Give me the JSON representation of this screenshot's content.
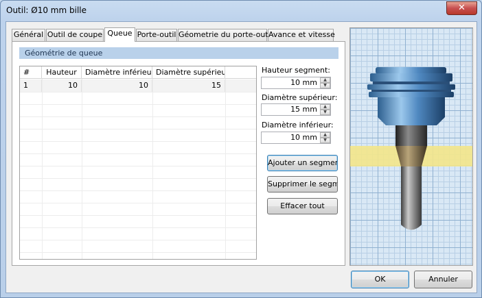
{
  "window": {
    "title": "Outil: Ø10 mm bille",
    "close_label": "✕"
  },
  "tabs": [
    {
      "label": "Général",
      "active": false
    },
    {
      "label": "Outil de coupe",
      "active": false
    },
    {
      "label": "Queue",
      "active": true
    },
    {
      "label": "Porte-outil",
      "active": false
    },
    {
      "label": "Géometrie du porte-outil",
      "active": false
    },
    {
      "label": "Avance et vitesse",
      "active": false
    }
  ],
  "section": {
    "title": "Géométrie de queue"
  },
  "grid": {
    "columns": [
      "#",
      "Hauteur",
      "Diamètre inférieur",
      "Diamètre supérieur"
    ],
    "rows": [
      [
        "1",
        "10",
        "10",
        "15"
      ]
    ]
  },
  "fields": {
    "hauteur_segment": {
      "label": "Hauteur segment:",
      "value": "10 mm"
    },
    "diametre_superieur": {
      "label": "Diamètre supérieur:",
      "value": "15 mm"
    },
    "diametre_inferieur": {
      "label": "Diamètre inférieur:",
      "value": "10 mm"
    }
  },
  "buttons": {
    "add_segment": "Ajouter un segment",
    "delete_segment": "Supprimer le segment",
    "clear_all": "Effacer tout",
    "ok": "OK",
    "cancel": "Annuler"
  },
  "preview": {
    "icon": "tool-shank-preview-icon",
    "highlight_color": "#f3e58a"
  },
  "colors": {
    "accent": "#b9d1ea",
    "focus_border": "#3c7fb1",
    "close_red": "#c75050"
  }
}
